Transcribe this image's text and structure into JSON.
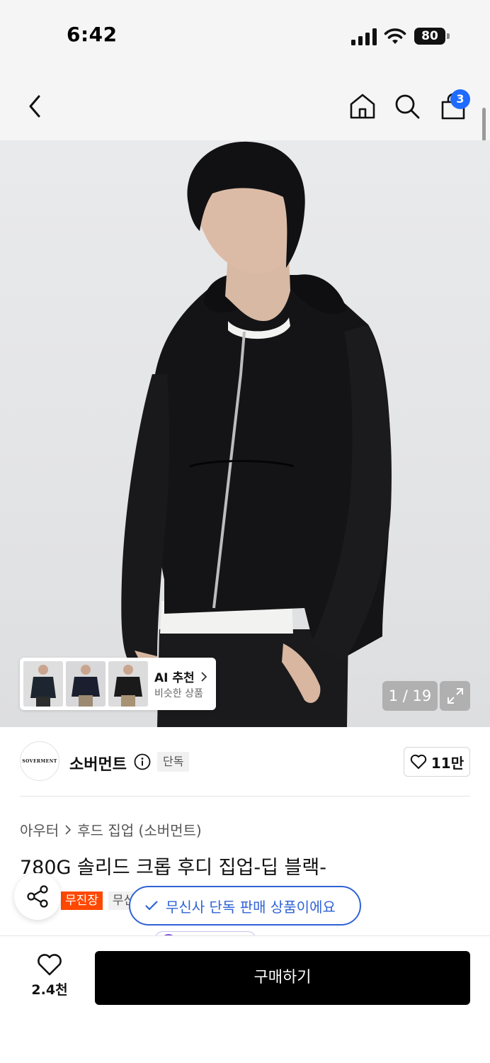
{
  "status_bar": {
    "time": "6:42",
    "battery": "80"
  },
  "nav": {
    "back_icon": "chevron-left-icon",
    "home_icon": "home-icon",
    "search_icon": "search-icon",
    "cart_icon": "shopping-bag-icon",
    "cart_count": "3"
  },
  "gallery": {
    "current_page": "1",
    "total_pages": "19",
    "counter": "1 / 19",
    "expand_icon": "expand-icon"
  },
  "ai_recommend": {
    "title": "AI 추천",
    "subtitle": "비슷한 상품"
  },
  "brand": {
    "logo_text": "SOVERMENT",
    "name": "소버먼트",
    "exclusive_tag": "단독",
    "likes": "11만"
  },
  "product": {
    "breadcrumb": [
      "아우터",
      "후드 집업 (소버먼트)"
    ],
    "title": "780G 솔리드 크롭 후디 집업-딥 블랙-",
    "tags": [
      "무진장",
      "무신"
    ]
  },
  "toast": {
    "message": "무신사 단독 판매 상품이에요"
  },
  "bottom_bar": {
    "wish_count": "2.4천",
    "buy_label": "구매하기"
  },
  "colors": {
    "accent_blue": "#1f6bff",
    "toast_blue": "#2f63d6",
    "tag_orange": "#ff4800",
    "buy_button": "#000000"
  }
}
